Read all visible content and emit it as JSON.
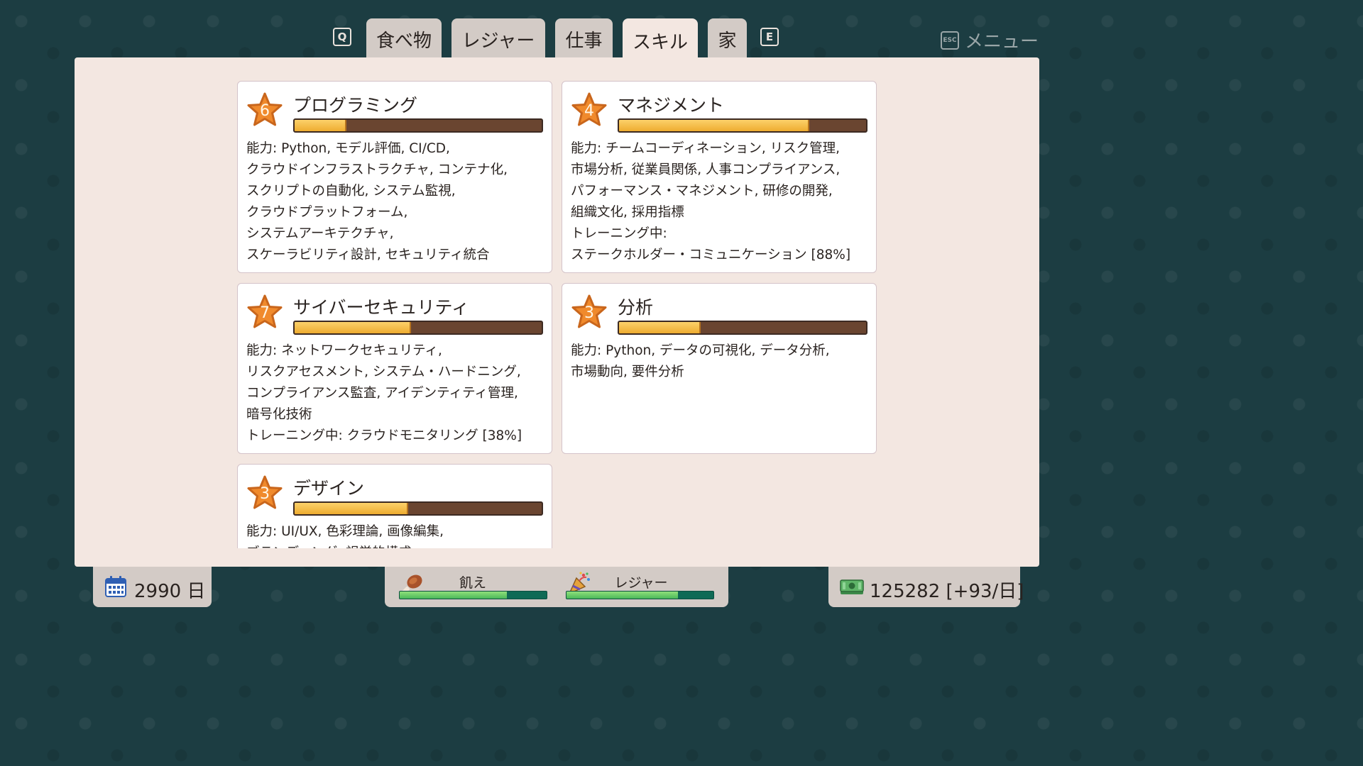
{
  "tabs": {
    "prev_key": "Q",
    "next_key": "E",
    "items": [
      {
        "label": "食べ物",
        "active": false
      },
      {
        "label": "レジャー",
        "active": false
      },
      {
        "label": "仕事",
        "active": false
      },
      {
        "label": "スキル",
        "active": true
      },
      {
        "label": "家",
        "active": false
      }
    ]
  },
  "menu": {
    "key": "ESC",
    "label": "メニュー"
  },
  "colors": {
    "star": "#f08a2c",
    "bar_fill": "#f0b03a",
    "bar_empty": "#6a4530",
    "need_fill": "#6ccf64",
    "need_empty": "#0f6a55"
  },
  "skills": [
    {
      "name": "プログラミング",
      "level": "6",
      "progress": 0.21,
      "lines": [
        "能力: Python, モデル評価, CI/CD,",
        "クラウドインフラストラクチャ, コンテナ化,",
        "スクリプトの自動化, システム監視,",
        "クラウドプラットフォーム,",
        "システムアーキテクチャ,",
        "スケーラビリティ設計, セキュリティ統合"
      ]
    },
    {
      "name": "マネジメント",
      "level": "4",
      "progress": 0.77,
      "lines": [
        "能力: チームコーディネーション, リスク管理,",
        "市場分析, 従業員関係, 人事コンプライアンス,",
        "パフォーマンス・マネジメント, 研修の開発,",
        "組織文化, 採用指標",
        "トレーニング中:",
        "ステークホルダー・コミュニケーション [88%]"
      ]
    },
    {
      "name": "サイバーセキュリティ",
      "level": "7",
      "progress": 0.47,
      "lines": [
        "能力: ネットワークセキュリティ,",
        "リスクアセスメント, システム・ハードニング,",
        "コンプライアンス監査, アイデンティティ管理,",
        "暗号化技術",
        "トレーニング中: クラウドモニタリング [38%]"
      ]
    },
    {
      "name": "分析",
      "level": "3",
      "progress": 0.33,
      "lines": [
        "能力: Python, データの可視化, データ分析,",
        "市場動向, 要件分析"
      ]
    },
    {
      "name": "デザイン",
      "level": "3",
      "progress": 0.46,
      "lines": [
        "能力: UI/UX, 色彩理論, 画像編集,",
        "ブランディング, 視覚的構成"
      ]
    }
  ],
  "hud": {
    "days": "2990 日",
    "hunger": {
      "label": "飢え",
      "level": 0.73
    },
    "leisure": {
      "label": "レジャー",
      "level": 0.76
    },
    "money": "125282 [+93/日]",
    "icons": {
      "days": "calendar-icon",
      "hunger": "drumstick-icon",
      "leisure": "party-popper-icon",
      "money": "cash-icon"
    }
  }
}
